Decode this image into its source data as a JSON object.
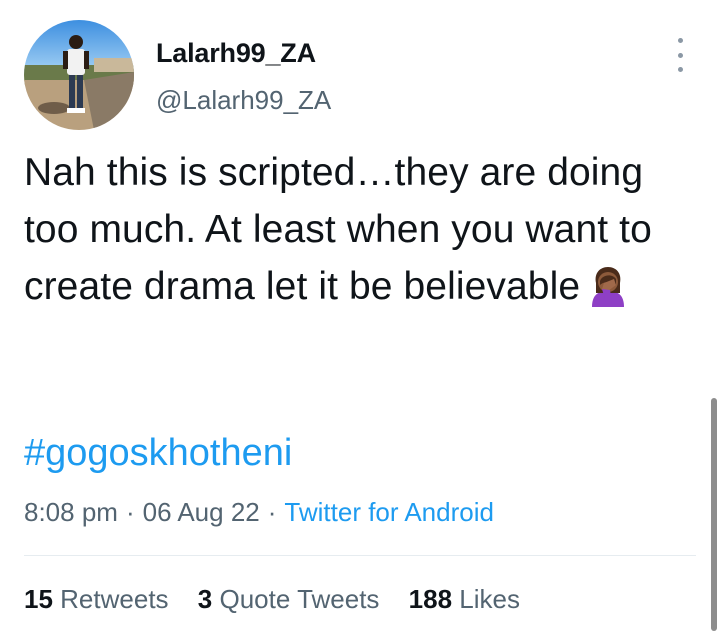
{
  "user": {
    "display_name": "Lalarh99_ZA",
    "handle": "@Lalarh99_ZA"
  },
  "tweet": {
    "text": "Nah this is scripted…they are doing too much. At least when you want to create drama let it be believable",
    "emoji": "woman-facepalming-icon",
    "hashtag": "#gogoskhotheni"
  },
  "meta": {
    "time": "8:08 pm",
    "separator": "·",
    "date": "06 Aug 22",
    "source": "Twitter for Android"
  },
  "stats": {
    "retweets_count": "15",
    "retweets_label": "Retweets",
    "quotes_count": "3",
    "quotes_label": "Quote Tweets",
    "likes_count": "188",
    "likes_label": "Likes"
  },
  "colors": {
    "link": "#1d9bf0",
    "secondary": "#536471",
    "text": "#0f1419"
  }
}
